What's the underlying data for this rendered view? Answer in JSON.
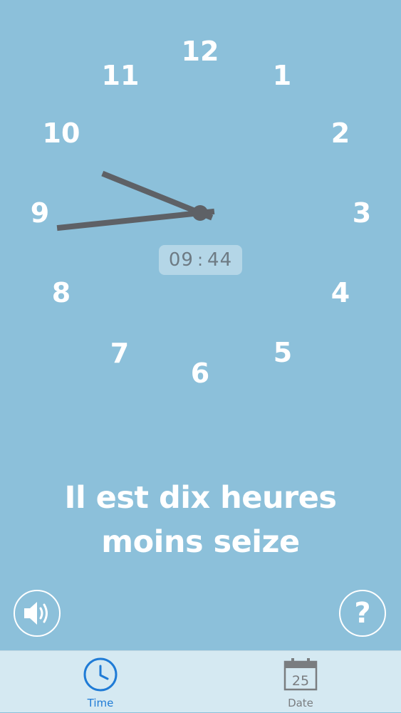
{
  "clock": {
    "numbers": [
      "12",
      "1",
      "2",
      "3",
      "4",
      "5",
      "6",
      "7",
      "8",
      "9",
      "10",
      "11"
    ],
    "hour": 9,
    "minute": 44,
    "hand_color": "#5e6166"
  },
  "digital": {
    "hours": "09",
    "separator": ":",
    "minutes": "44"
  },
  "phrase": {
    "line1": "Il est dix heures",
    "line2": "moins seize"
  },
  "buttons": {
    "sound_icon": "speaker-icon",
    "help_label": "?"
  },
  "tabs": [
    {
      "label": "Time",
      "icon": "clock-icon",
      "active": true
    },
    {
      "label": "Date",
      "icon": "calendar-icon",
      "active": false,
      "calendar_day": "25"
    }
  ],
  "colors": {
    "background": "#8cc0da",
    "tab_bar": "#d5e9f2",
    "tab_active": "#1f7bd6",
    "tab_inactive": "#7a7d80"
  }
}
